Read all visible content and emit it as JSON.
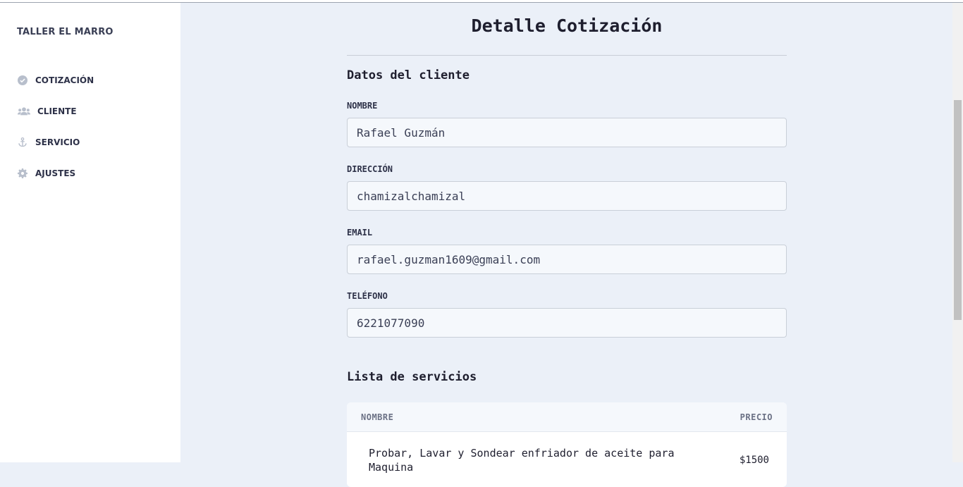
{
  "sidebar": {
    "brand": "TALLER EL MARRO",
    "items": [
      {
        "label": "COTIZACIÓN",
        "icon": "check-circle-icon"
      },
      {
        "label": "CLIENTE",
        "icon": "users-icon"
      },
      {
        "label": "SERVICIO",
        "icon": "anchor-icon"
      },
      {
        "label": "AJUSTES",
        "icon": "gear-icon"
      }
    ]
  },
  "main": {
    "title": "Detalle Cotización",
    "client_section": "Datos del cliente",
    "fields": [
      {
        "label": "NOMBRE",
        "value": "Rafael Guzmán"
      },
      {
        "label": "DIRECCIÓN",
        "value": "chamizalchamizal"
      },
      {
        "label": "EMAIL",
        "value": "rafael.guzman1609@gmail.com"
      },
      {
        "label": "TELÉFONO",
        "value": "6221077090"
      }
    ],
    "services_section": "Lista de servicios",
    "table": {
      "headers": {
        "name": "NOMBRE",
        "price": "PRECIO"
      },
      "rows": [
        {
          "name": "Probar, Lavar y Sondear enfriador de aceite para Maquina",
          "price": "$1500"
        }
      ]
    }
  },
  "colors": {
    "background": "#ebf0f8",
    "sidebar": "#ffffff",
    "icon": "#b8bfcc"
  }
}
